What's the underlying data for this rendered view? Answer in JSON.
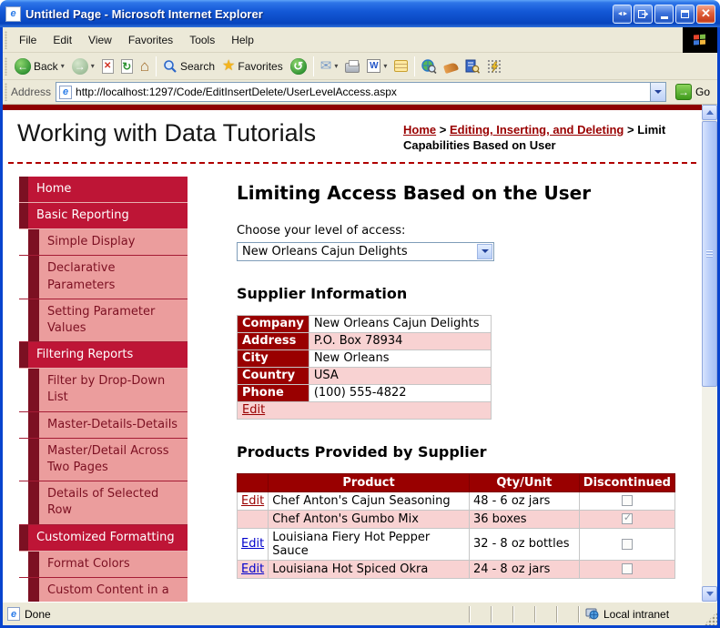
{
  "window": {
    "title": "Untitled Page - Microsoft Internet Explorer"
  },
  "menu": {
    "items": [
      "File",
      "Edit",
      "View",
      "Favorites",
      "Tools",
      "Help"
    ]
  },
  "toolbar": {
    "back": "Back",
    "search": "Search",
    "favorites": "Favorites"
  },
  "address": {
    "label": "Address",
    "url": "http://localhost:1297/Code/EditInsertDelete/UserLevelAccess.aspx",
    "go": "Go"
  },
  "header": {
    "site_title": "Working with Data Tutorials",
    "breadcrumb": {
      "separator": ">",
      "items": [
        {
          "label": "Home",
          "link": true
        },
        {
          "label": "Editing, Inserting, and Deleting",
          "link": true
        },
        {
          "label": "Limit Capabilities Based on User",
          "link": false
        }
      ]
    }
  },
  "sidebar": {
    "items": [
      {
        "label": "Home",
        "level": 1
      },
      {
        "label": "Basic Reporting",
        "level": 1
      },
      {
        "label": "Simple Display",
        "level": 2
      },
      {
        "label": "Declarative Parameters",
        "level": 2
      },
      {
        "label": "Setting Parameter Values",
        "level": 2
      },
      {
        "label": "Filtering Reports",
        "level": 1
      },
      {
        "label": "Filter by Drop-Down List",
        "level": 2
      },
      {
        "label": "Master-Details-Details",
        "level": 2
      },
      {
        "label": "Master/Detail Across Two Pages",
        "level": 2
      },
      {
        "label": "Details of Selected Row",
        "level": 2
      },
      {
        "label": "Customized Formatting",
        "level": 1
      },
      {
        "label": "Format Colors",
        "level": 2
      },
      {
        "label": "Custom Content in a",
        "level": 2
      }
    ]
  },
  "main": {
    "heading": "Limiting Access Based on the User",
    "access_label": "Choose your level of access:",
    "access_value": "New Orleans Cajun Delights",
    "supplier_heading": "Supplier Information",
    "supplier_rows": [
      {
        "label": "Company",
        "value": "New Orleans Cajun Delights"
      },
      {
        "label": "Address",
        "value": "P.O. Box 78934"
      },
      {
        "label": "City",
        "value": "New Orleans"
      },
      {
        "label": "Country",
        "value": "USA"
      },
      {
        "label": "Phone",
        "value": "(100) 555-4822"
      }
    ],
    "supplier_edit": "Edit",
    "products_heading": "Products Provided by Supplier",
    "products_columns": [
      "",
      "Product",
      "Qty/Unit",
      "Discontinued"
    ],
    "products_rows": [
      {
        "edit": "Edit",
        "visited": true,
        "product": "Chef Anton's Cajun Seasoning",
        "qty": "48 - 6 oz jars",
        "discontinued": false
      },
      {
        "edit": "",
        "visited": false,
        "product": "Chef Anton's Gumbo Mix",
        "qty": "36 boxes",
        "discontinued": true
      },
      {
        "edit": "Edit",
        "visited": false,
        "product": "Louisiana Fiery Hot Pepper Sauce",
        "qty": "32 - 8 oz bottles",
        "discontinued": false
      },
      {
        "edit": "Edit",
        "visited": false,
        "product": "Louisiana Hot Spiced Okra",
        "qty": "24 - 8 oz jars",
        "discontinued": false
      }
    ]
  },
  "statusbar": {
    "status": "Done",
    "zone": "Local intranet"
  },
  "colors": {
    "maroon": "#990000",
    "nav_red": "#BE1536",
    "nav_dark": "#7C1022",
    "nav_pink": "#EB9D9D",
    "row_pink": "#F8D2D2",
    "link_blue": "#0000CC",
    "xp_blue_border": "#0944CE",
    "chrome": "#ECE9D8"
  },
  "icons": {
    "back_arrow": "←",
    "forward_arrow": "→",
    "stop_glyph": "✕",
    "refresh_glyph": "↻",
    "home_glyph": "⌂",
    "star_glyph": "★",
    "history_glyph": "↺",
    "mail_glyph": "✉",
    "word_glyph": "W",
    "go_arrow": "→",
    "title_arrows": "◄►",
    "close_glyph": "✕",
    "ie_glyph": "e"
  }
}
